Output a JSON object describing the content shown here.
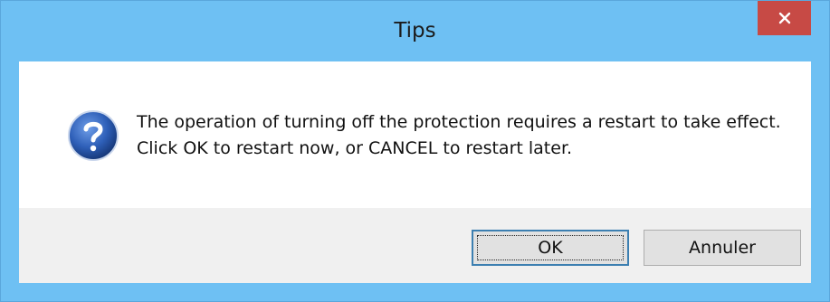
{
  "window": {
    "title": "Tips",
    "close_icon": "close-x-icon"
  },
  "message": {
    "icon": "question-icon",
    "text": "The operation of turning off the protection requires a restart to take effect. Click OK to restart now, or CANCEL to restart later."
  },
  "buttons": {
    "ok_label": "OK",
    "cancel_label": "Annuler"
  },
  "colors": {
    "titlebar": "#6ec0f3",
    "close_button": "#c74a45",
    "button_bar": "#f0f0f0",
    "question_icon": "#2e5fb8"
  }
}
